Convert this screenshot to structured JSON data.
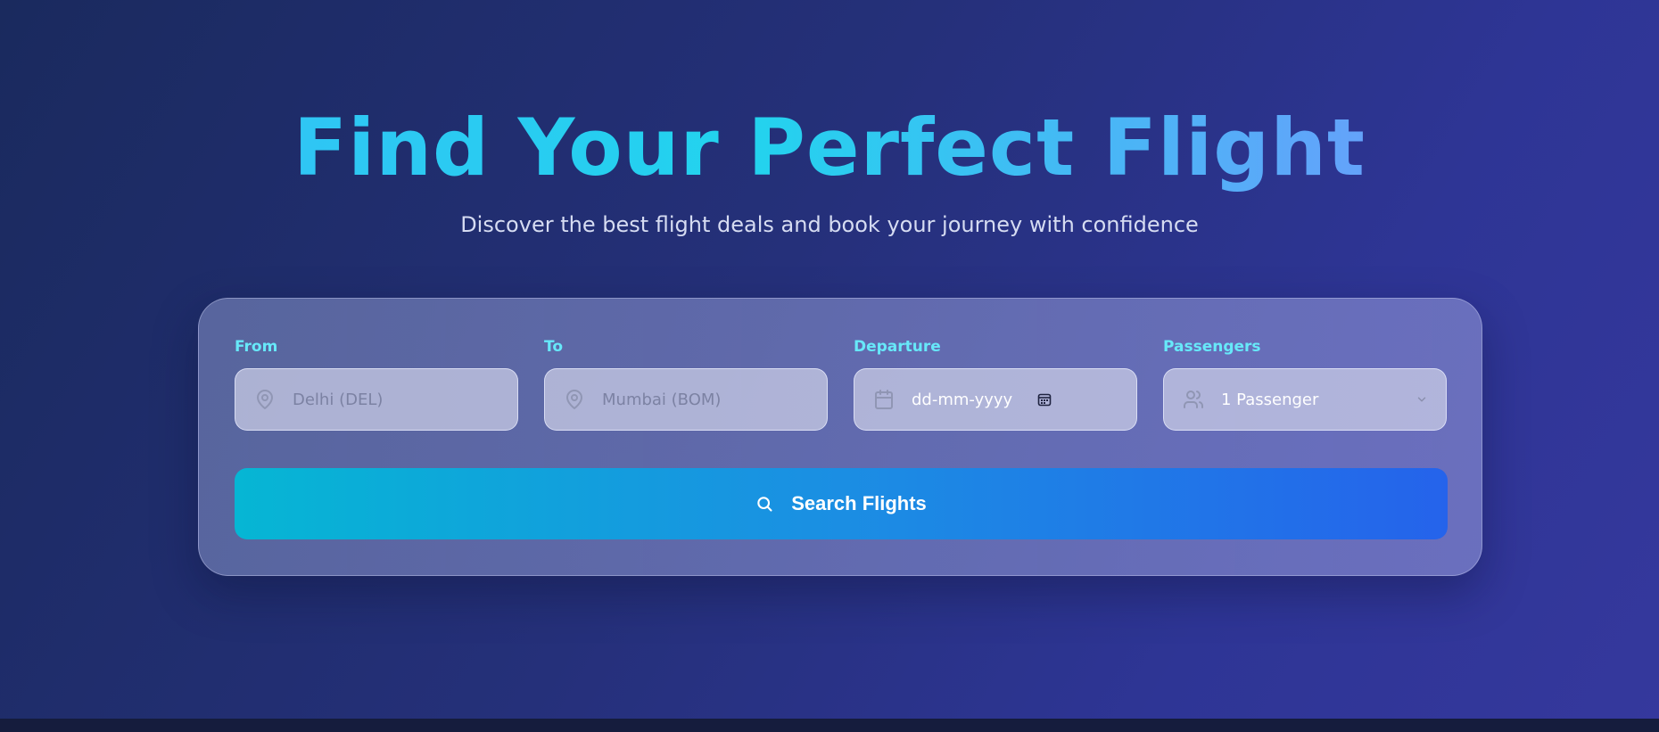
{
  "hero": {
    "title": "Find Your Perfect Flight",
    "subtitle": "Discover the best flight deals and book your journey with confidence"
  },
  "search_form": {
    "from": {
      "label": "From",
      "placeholder": "Delhi (DEL)",
      "icon": "map-pin-icon"
    },
    "to": {
      "label": "To",
      "placeholder": "Mumbai (BOM)",
      "icon": "map-pin-icon"
    },
    "departure": {
      "label": "Departure",
      "placeholder": "dd-mm-yyyy",
      "icon": "calendar-icon",
      "picker_icon": "calendar-picker-icon"
    },
    "passengers": {
      "label": "Passengers",
      "value": "1 Passenger",
      "icon": "users-icon",
      "dropdown_icon": "chevron-down-icon"
    },
    "submit": {
      "label": "Search Flights",
      "icon": "search-icon"
    }
  },
  "colors": {
    "accent_label": "#67e8f9",
    "button_start": "#06b6d4",
    "button_end": "#2563eb",
    "background_start": "#1a2a5e",
    "background_end": "#35389d"
  }
}
